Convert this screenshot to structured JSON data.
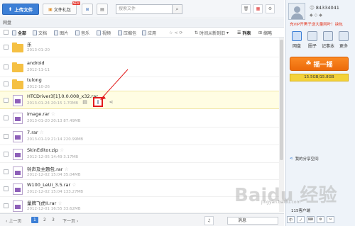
{
  "toolbar": {
    "upload_label": "上传文件",
    "gift_label": "文件礼包",
    "new_badge": "NEW",
    "search_placeholder": "搜索文件"
  },
  "breadcrumb": {
    "root": "网盘"
  },
  "filters": {
    "all": "全部",
    "doc": "文档",
    "pic": "图片",
    "music": "音乐",
    "video": "视频",
    "zip": "压缩包",
    "app": "应用",
    "sort": "时间从新到旧",
    "list": "列表",
    "thumb": "缩略"
  },
  "files": [
    {
      "name": "乐",
      "meta": "2013-01-20",
      "type": "folder"
    },
    {
      "name": "android",
      "meta": "2012-11-11",
      "type": "folder"
    },
    {
      "name": "tulong",
      "meta": "2012-10-26",
      "type": "folder"
    },
    {
      "name": "HTCDriver3[1].0.0.008_x32.rar",
      "meta": "2013-01-24 20:15   1.70MB",
      "type": "rar"
    },
    {
      "name": "image.rar",
      "meta": "2013-01-20 20:13   87.49MB",
      "type": "rar"
    },
    {
      "name": "7.rar",
      "meta": "2013-01-19 21:14   220.99MB",
      "type": "rar"
    },
    {
      "name": "SkinEditor.zip",
      "meta": "2012-12-05 14:49   3.17MB",
      "type": "rar"
    },
    {
      "name": "铃声及主题包.rar",
      "meta": "2012-12-02 15:04   35.04MB",
      "type": "rar"
    },
    {
      "name": "W100_LeUi_3.5.rar",
      "meta": "2012-12-02 15:04   133.27MB",
      "type": "rar"
    },
    {
      "name": "量牌飞虎II.rar",
      "meta": "2012-12-01 16:55   33.62MB",
      "type": "rar"
    }
  ],
  "pagination": {
    "prev": "上一页",
    "pages": [
      "1",
      "2",
      "3"
    ],
    "next": "下一页"
  },
  "bottom": {
    "message": "消息"
  },
  "right": {
    "user_id": "84334041",
    "vip_text": "充VIP开黑子送大量网叶！抉包",
    "tabs": [
      "网盘",
      "圈子",
      "记事本",
      "更多"
    ],
    "shake": "摇一摇",
    "quota": "15.5GB/15.8GB",
    "share_space": "我的分享空间",
    "client": "115客户端",
    "bottom_icons": [
      "中",
      "ノ"
    ]
  },
  "watermark": {
    "main": "Baidu 经验",
    "sub": "jingyan.baidu.com"
  },
  "colors": {
    "accent": "#3c7fd6",
    "highlight": "#e21b1b",
    "orange": "#f07a17"
  }
}
